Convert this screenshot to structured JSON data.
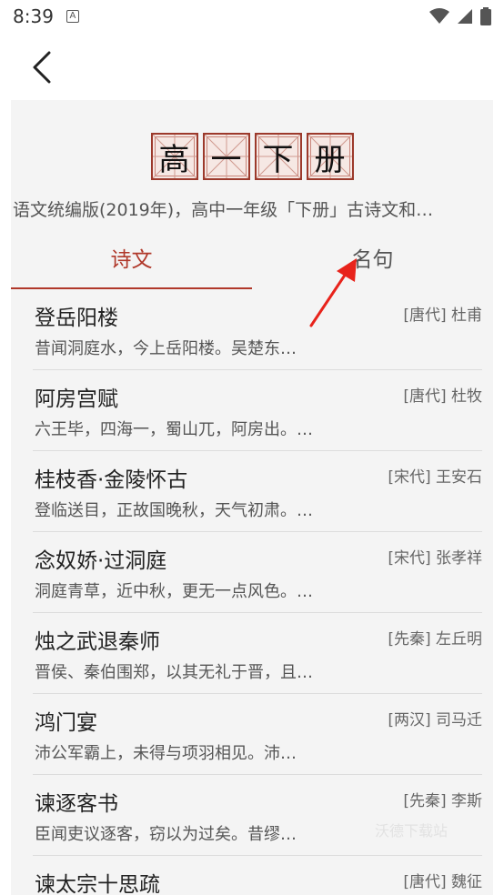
{
  "status": {
    "time": "8:39",
    "notif": "A"
  },
  "title_chars": [
    "高",
    "一",
    "下",
    "册"
  ],
  "subtitle": "语文统编版(2019年)，高中一年级「下册」古诗文和…",
  "tabs": [
    {
      "label": "诗文"
    },
    {
      "label": "名句"
    }
  ],
  "items": [
    {
      "title": "登岳阳楼",
      "author": "[唐代] 杜甫",
      "excerpt": "昔闻洞庭水，今上岳阳楼。吴楚东…"
    },
    {
      "title": "阿房宫赋",
      "author": "[唐代] 杜牧",
      "excerpt": "六王毕，四海一，蜀山兀，阿房出。…"
    },
    {
      "title": "桂枝香·金陵怀古",
      "author": "[宋代] 王安石",
      "excerpt": "登临送目，正故国晚秋，天气初肃。…"
    },
    {
      "title": "念奴娇·过洞庭",
      "author": "[宋代] 张孝祥",
      "excerpt": "洞庭青草，近中秋，更无一点风色。…"
    },
    {
      "title": "烛之武退秦师",
      "author": "[先秦] 左丘明",
      "excerpt": "晋侯、秦伯围郑，以其无礼于晋，且…"
    },
    {
      "title": "鸿门宴",
      "author": "[两汉] 司马迁",
      "excerpt": "沛公军霸上，未得与项羽相见。沛…"
    },
    {
      "title": "谏逐客书",
      "author": "[先秦] 李斯",
      "excerpt": "臣闻吏议逐客，窃以为过矣。昔缪…"
    },
    {
      "title": "谏太宗十思疏",
      "author": "[唐代] 魏征",
      "excerpt": ""
    }
  ],
  "watermark": "沃德下载站",
  "colors": {
    "accent": "#b0382a",
    "card_bg": "#f4f4f4"
  }
}
